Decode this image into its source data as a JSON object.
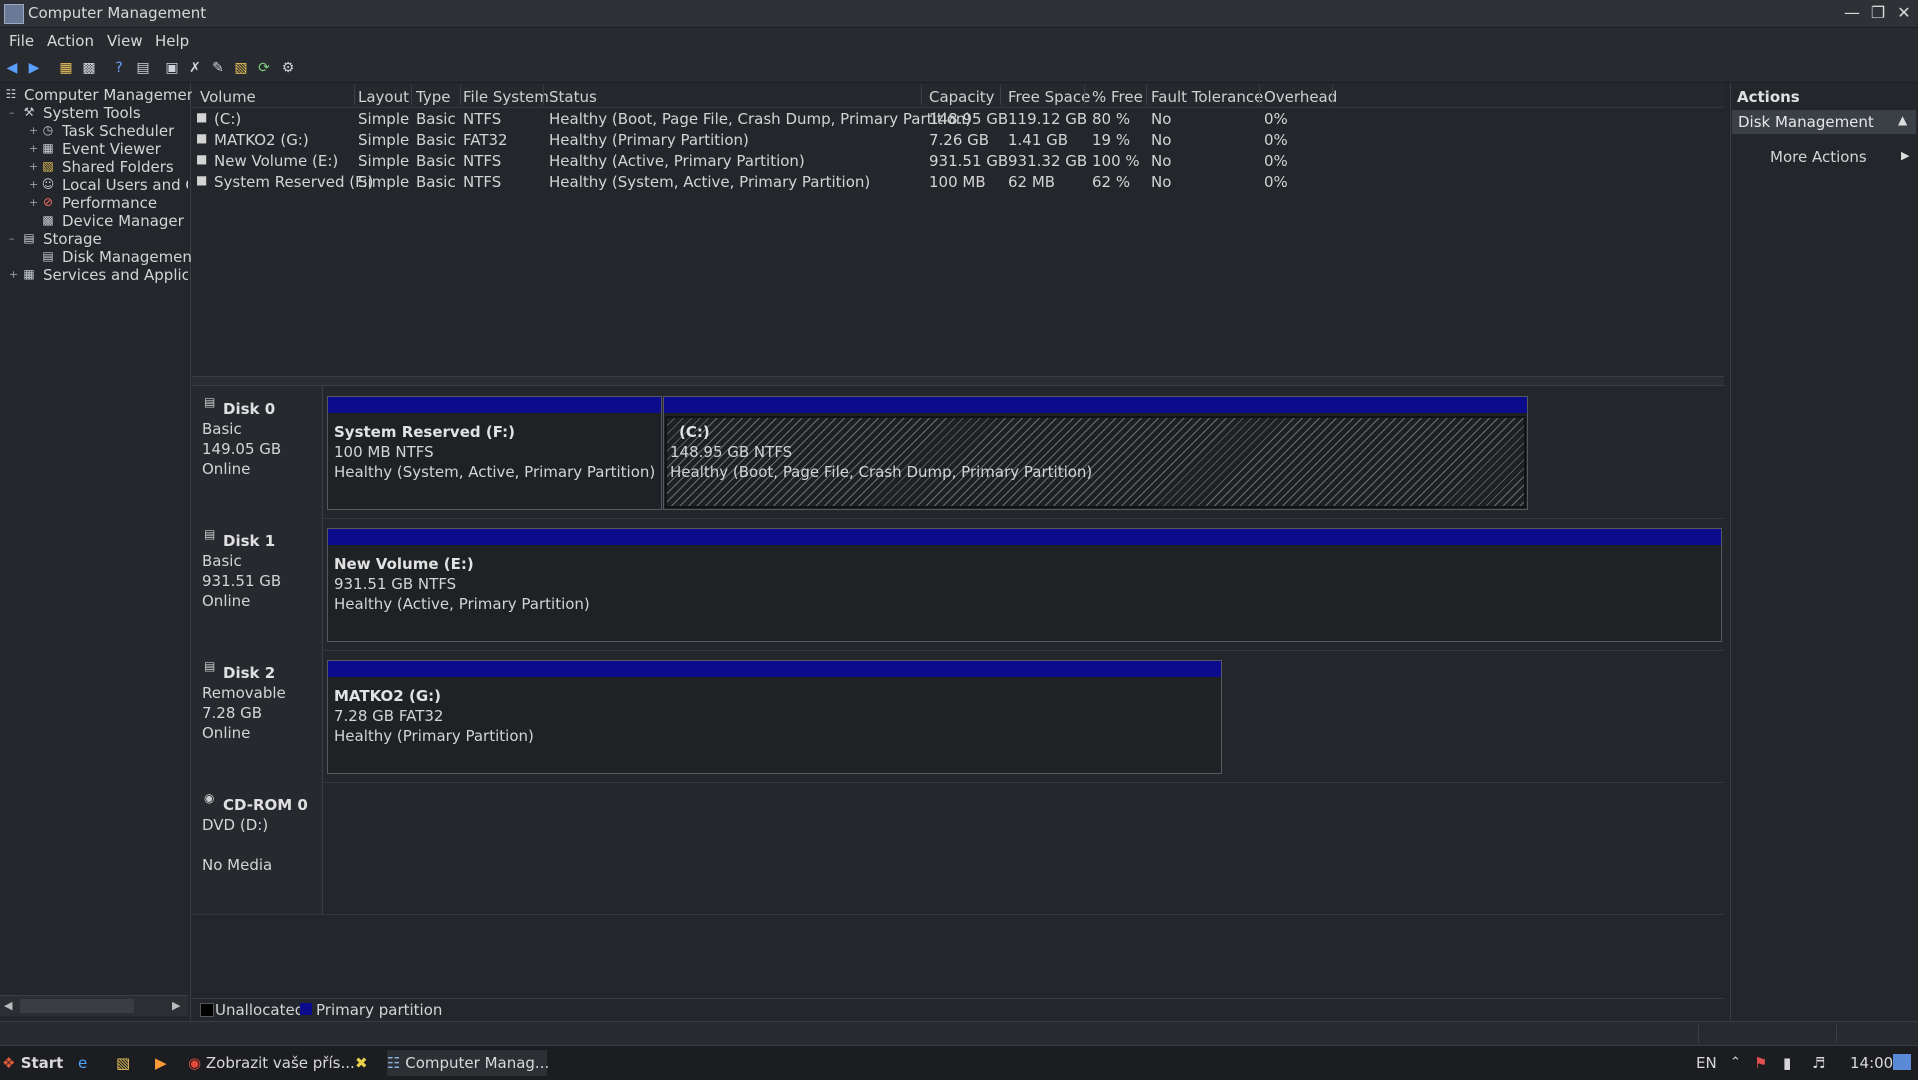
{
  "window": {
    "title": "Computer Management"
  },
  "menu": [
    "File",
    "Action",
    "View",
    "Help"
  ],
  "tree": {
    "root": "Computer Management",
    "system_tools": "System Tools",
    "task_scheduler": "Task Scheduler",
    "event_viewer": "Event Viewer",
    "shared_folders": "Shared Folders",
    "local_users": "Local Users and Gr",
    "performance": "Performance",
    "device_manager": "Device Manager",
    "storage": "Storage",
    "disk_management": "Disk Management",
    "services": "Services and Applicat"
  },
  "volume_table": {
    "columns": [
      "Volume",
      "Layout",
      "Type",
      "File System",
      "Status",
      "Capacity",
      "Free Space",
      "% Free",
      "Fault Tolerance",
      "Overhead"
    ],
    "rows": [
      [
        "(C:)",
        "Simple",
        "Basic",
        "NTFS",
        "Healthy (Boot, Page File, Crash Dump, Primary Partition)",
        "148.95 GB",
        "119.12 GB",
        "80 %",
        "No",
        "0%"
      ],
      [
        "MATKO2 (G:)",
        "Simple",
        "Basic",
        "FAT32",
        "Healthy (Primary Partition)",
        "7.26 GB",
        "1.41 GB",
        "19 %",
        "No",
        "0%"
      ],
      [
        "New Volume (E:)",
        "Simple",
        "Basic",
        "NTFS",
        "Healthy (Active, Primary Partition)",
        "931.51 GB",
        "931.32 GB",
        "100 %",
        "No",
        "0%"
      ],
      [
        "System Reserved (F:)",
        "Simple",
        "Basic",
        "NTFS",
        "Healthy (System, Active, Primary Partition)",
        "100 MB",
        "62 MB",
        "62 %",
        "No",
        "0%"
      ]
    ]
  },
  "disks": {
    "disk0": {
      "name": "Disk 0",
      "type": "Basic",
      "size": "149.05 GB",
      "state": "Online",
      "p1": {
        "name": "System Reserved  (F:)",
        "size": "100 MB NTFS",
        "status": "Healthy (System, Active, Primary Partition)"
      },
      "p2": {
        "name": "(C:)",
        "size": "148.95 GB NTFS",
        "status": "Healthy (Boot, Page File, Crash Dump, Primary Partition)"
      }
    },
    "disk1": {
      "name": "Disk 1",
      "type": "Basic",
      "size": "931.51 GB",
      "state": "Online",
      "p1": {
        "name": "New Volume  (E:)",
        "size": "931.51 GB NTFS",
        "status": "Healthy (Active, Primary Partition)"
      }
    },
    "disk2": {
      "name": "Disk 2",
      "type": "Removable",
      "size": "7.28 GB",
      "state": "Online",
      "p1": {
        "name": "MATKO2  (G:)",
        "size": "7.28 GB FAT32",
        "status": "Healthy (Primary Partition)"
      }
    },
    "cdrom0": {
      "name": "CD-ROM 0",
      "type": "DVD (D:)",
      "state": "No Media"
    }
  },
  "legend": {
    "unallocated": "Unallocated",
    "primary": "Primary partition",
    "unallocated_color": "#000000",
    "primary_color": "#0b0b8c"
  },
  "actions": {
    "header": "Actions",
    "section": "Disk Management",
    "more": "More Actions"
  },
  "taskbar": {
    "start": "Start",
    "chrome_task": "Zobrazit vaše přís...",
    "cm_task": "Computer Manag...",
    "lang": "EN",
    "clock": "14:00"
  }
}
